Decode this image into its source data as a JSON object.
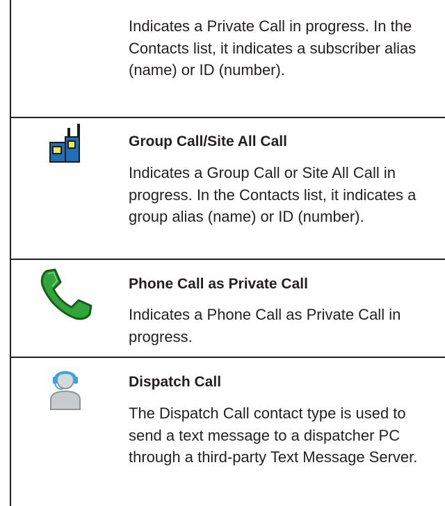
{
  "rows": [
    {
      "icon": "private-call-icon",
      "title": "",
      "description": "Indicates a Private Call in progress. In the Contacts list, it indicates a subscriber alias (name) or ID (number)."
    },
    {
      "icon": "group-call-radios-icon",
      "title": "Group Call/Site All Call",
      "description": "Indicates a Group Call or Site All Call in progress. In the Contacts list, it indicates a group alias (name) or ID (number)."
    },
    {
      "icon": "green-phone-handset-icon",
      "title": "Phone Call as Private Call",
      "description": "Indicates a Phone Call as Private Call in progress."
    },
    {
      "icon": "dispatcher-headset-icon",
      "title": "Dispatch Call",
      "description": "The Dispatch Call contact type is used to send a text message to a dispatcher PC through a third-party Text Message Server."
    }
  ],
  "colors": {
    "text": "#231f20",
    "rule": "#231f20",
    "radio_blue": "#1e6fb8",
    "radio_dark": "#1b1b1b",
    "radio_screen": "#f2e94e",
    "phone_green": "#2fa53a",
    "headset_blue": "#35a6e0",
    "person_gray": "#c8cccd"
  }
}
